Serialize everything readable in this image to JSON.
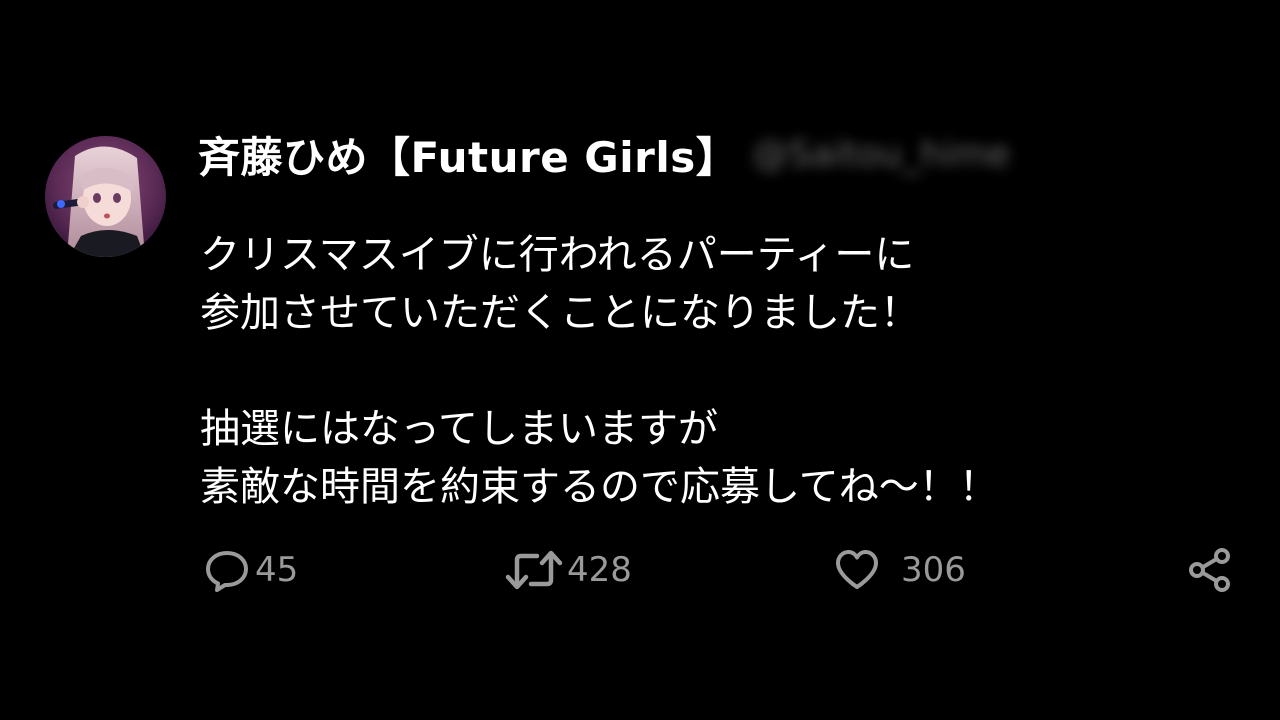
{
  "author": {
    "display_name": "斉藤ひめ【Future Girls】",
    "handle": "@Saitou_hime",
    "avatar": "avatar-image"
  },
  "tweet": {
    "lines": [
      "クリスマスイブに行われるパーティーに",
      "参加させていただくことになりました！",
      "",
      "抽選にはなってしまいますが",
      "素敵な時間を約束するので応募してね〜！！"
    ]
  },
  "actions": {
    "reply": {
      "icon": "reply-icon",
      "count": "45"
    },
    "retweet": {
      "icon": "retweet-icon",
      "count": "428"
    },
    "like": {
      "icon": "heart-icon",
      "count": "306"
    },
    "share": {
      "icon": "share-icon"
    }
  },
  "colors": {
    "background": "#000000",
    "text": "#ffffff",
    "muted": "#9a9a9a"
  }
}
